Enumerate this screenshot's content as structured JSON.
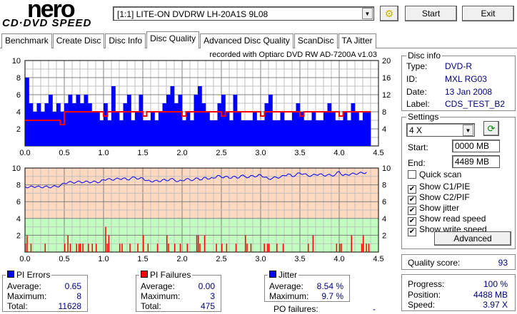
{
  "app": {
    "logo_top": "nero",
    "logo_bottom": "CD·DVD SPEED"
  },
  "toolbar": {
    "drive": "[1:1]  LITE-ON DVDRW LH-20A1S 9L08",
    "start": "Start",
    "exit": "Exit",
    "drive_icon": "drive-config-icon"
  },
  "tabs": [
    {
      "label": "Benchmark"
    },
    {
      "label": "Create Disc"
    },
    {
      "label": "Disc Info"
    },
    {
      "label": "Disc Quality",
      "active": true
    },
    {
      "label": "Advanced Disc Quality"
    },
    {
      "label": "ScanDisc"
    },
    {
      "label": "TA Jitter"
    }
  ],
  "disc_info": {
    "title": "Disc info",
    "type_label": "Type:",
    "type": "DVD-R",
    "id_label": "ID:",
    "id": "MXL RG03",
    "date_label": "Date:",
    "date": "13 Jan 2008",
    "label_label": "Label:",
    "label": "CDS_TEST_B2"
  },
  "settings": {
    "title": "Settings",
    "speed": "4 X",
    "start_label": "Start:",
    "start": "0000 MB",
    "end_label": "End:",
    "end": "4489 MB",
    "checks": [
      {
        "label": "Quick scan",
        "checked": false
      },
      {
        "label": "Show C1/PIE",
        "checked": true
      },
      {
        "label": "Show C2/PIF",
        "checked": true
      },
      {
        "label": "Show jitter",
        "checked": true
      },
      {
        "label": "Show read speed",
        "checked": true
      },
      {
        "label": "Show write speed",
        "checked": true
      }
    ],
    "advanced": "Advanced"
  },
  "quality": {
    "label": "Quality score:",
    "value": "93"
  },
  "progress": {
    "progress_label": "Progress:",
    "progress": "100 %",
    "position_label": "Position:",
    "position": "4488 MB",
    "speed_label": "Speed:",
    "speed": "3.97 X"
  },
  "pi_errors": {
    "title": "PI Errors",
    "color": "#0000ff",
    "avg_label": "Average:",
    "avg": "0.65",
    "max_label": "Maximum:",
    "max": "8",
    "total_label": "Total:",
    "total": "11628"
  },
  "pi_failures": {
    "title": "PI Failures",
    "color": "#ff0000",
    "avg_label": "Average:",
    "avg": "0.00",
    "max_label": "Maximum:",
    "max": "3",
    "total_label": "Total:",
    "total": "475"
  },
  "jitter": {
    "title": "Jitter",
    "color": "#0000ff",
    "avg_label": "Average:",
    "avg": "8.54 %",
    "max_label": "Maximum:",
    "max": "9.7 %",
    "po_label": "PO failures:",
    "po": "-"
  },
  "chart_data": [
    {
      "type": "bar",
      "title": "recorded with Optiarc DVD RW AD-7200A  v1.03",
      "xlim": [
        0,
        4.5
      ],
      "ylim": [
        0,
        10
      ],
      "y2lim": [
        0,
        20
      ],
      "xticks": [
        "0.0",
        "0.5",
        "1.0",
        "1.5",
        "2.0",
        "2.5",
        "3.0",
        "3.5",
        "4.0",
        "4.5"
      ],
      "yticks": [
        "2",
        "4",
        "6",
        "8",
        "10"
      ],
      "y2ticks": [
        "4",
        "8",
        "12",
        "16",
        "20"
      ],
      "grid": true,
      "x_step": 0.05,
      "pie": [
        8,
        5,
        4,
        5,
        4,
        5,
        6,
        4,
        5,
        4,
        5,
        6,
        5,
        6,
        5,
        6,
        5,
        4,
        4,
        3,
        5,
        3,
        7,
        4,
        3,
        5,
        6,
        3,
        4,
        6,
        3,
        3,
        4,
        3,
        4,
        5,
        6,
        7,
        5,
        6,
        3,
        4,
        3,
        6,
        7,
        5,
        4,
        3,
        3,
        5,
        6,
        4,
        3,
        6,
        4,
        3,
        3,
        3,
        4,
        3,
        3,
        5,
        6,
        3,
        3,
        4,
        3,
        3,
        4,
        5,
        4,
        3,
        3,
        4,
        3,
        3,
        4,
        5,
        4,
        3,
        3,
        4,
        3,
        5,
        4,
        3,
        4,
        4
      ],
      "read_speed": [
        6,
        6,
        6,
        6,
        6,
        6,
        6,
        6,
        6,
        5,
        8,
        8,
        8,
        8,
        8,
        8,
        8,
        8,
        8,
        8,
        7,
        8,
        8,
        8,
        8,
        8,
        8,
        8,
        8,
        8,
        7,
        8,
        8,
        8,
        8,
        8,
        8,
        8,
        8,
        8,
        7,
        8,
        8,
        8,
        8,
        8,
        8,
        8,
        8,
        8,
        7,
        8,
        8,
        8,
        8,
        8,
        8,
        8,
        8,
        8,
        7,
        8,
        8,
        8,
        8,
        8,
        8,
        8,
        8,
        8,
        7,
        8,
        8,
        8,
        8,
        8,
        8,
        8,
        8,
        8,
        7,
        8,
        8,
        8,
        8,
        8,
        8,
        8
      ],
      "pie_color": "#0000ff",
      "speed_color": "#ff0000"
    },
    {
      "type": "bar+line",
      "xlim": [
        0,
        4.5
      ],
      "ylim": [
        0,
        10
      ],
      "xticks": [
        "0.0",
        "0.5",
        "1.0",
        "1.5",
        "2.0",
        "2.5",
        "3.0",
        "3.5",
        "4.0",
        "4.5"
      ],
      "yticks": [
        "2",
        "4",
        "6",
        "8",
        "10"
      ],
      "y2ticks": [
        "2",
        "4",
        "6",
        "8",
        "10"
      ],
      "grid": true,
      "bands": [
        {
          "from": 0,
          "to": 4,
          "color": "#c0ffc0"
        },
        {
          "from": 4,
          "to": 10,
          "color": "#ffd8c0"
        }
      ],
      "pif": [
        [
          0.0,
          1
        ],
        [
          0.02,
          2
        ],
        [
          0.07,
          1
        ],
        [
          0.25,
          1
        ],
        [
          0.5,
          1
        ],
        [
          0.54,
          2
        ],
        [
          0.57,
          1
        ],
        [
          0.65,
          1
        ],
        [
          0.68,
          1
        ],
        [
          0.7,
          1
        ],
        [
          0.73,
          1
        ],
        [
          0.8,
          1
        ],
        [
          0.85,
          1
        ],
        [
          0.9,
          1
        ],
        [
          1.02,
          3
        ],
        [
          1.04,
          1
        ],
        [
          1.06,
          2
        ],
        [
          1.2,
          1
        ],
        [
          1.23,
          1
        ],
        [
          1.33,
          1
        ],
        [
          1.43,
          1
        ],
        [
          1.5,
          2
        ],
        [
          1.56,
          1
        ],
        [
          1.68,
          1
        ],
        [
          1.8,
          2
        ],
        [
          1.82,
          1
        ],
        [
          1.9,
          1
        ],
        [
          1.97,
          1
        ],
        [
          2.06,
          1
        ],
        [
          2.18,
          2
        ],
        [
          2.2,
          2
        ],
        [
          2.22,
          1
        ],
        [
          2.28,
          2
        ],
        [
          2.43,
          1
        ],
        [
          2.5,
          1
        ],
        [
          2.56,
          1
        ],
        [
          2.68,
          1
        ],
        [
          2.8,
          2
        ],
        [
          2.82,
          1
        ],
        [
          2.87,
          1
        ],
        [
          3.04,
          1
        ],
        [
          3.08,
          1
        ],
        [
          3.1,
          1
        ],
        [
          3.2,
          1
        ],
        [
          3.28,
          1
        ],
        [
          3.6,
          1
        ],
        [
          3.66,
          2
        ],
        [
          3.96,
          1
        ],
        [
          4.0,
          1
        ],
        [
          4.02,
          1
        ],
        [
          4.15,
          2
        ],
        [
          4.28,
          1
        ],
        [
          4.3,
          2
        ],
        [
          4.34,
          1
        ],
        [
          4.37,
          1
        ]
      ],
      "jitter": [
        7.8,
        7.7,
        7.8,
        7.8,
        7.7,
        7.8,
        7.7,
        7.8,
        7.8,
        7.9,
        8.2,
        8.3,
        8.3,
        8.3,
        8.4,
        8.3,
        8.4,
        8.3,
        8.4,
        8.3,
        8.6,
        8.7,
        8.6,
        8.7,
        8.7,
        8.8,
        8.6,
        8.8,
        8.9,
        8.7,
        8.8,
        8.5,
        8.4,
        8.5,
        8.4,
        8.6,
        8.5,
        8.7,
        8.6,
        8.4,
        8.5,
        8.7,
        8.6,
        8.6,
        8.8,
        8.6,
        8.9,
        8.7,
        8.8,
        9.1,
        8.9,
        9.0,
        8.8,
        9.0,
        8.8,
        9.1,
        9.0,
        8.9,
        9.1,
        9.0,
        9.2,
        8.9,
        8.7,
        8.8,
        8.9,
        8.9,
        9.1,
        9.3,
        9.0,
        9.2,
        9.4,
        9.3,
        9.1,
        9.1,
        9.2,
        9.3,
        9.1,
        9.2,
        9.1,
        9.2,
        9.6,
        9.1,
        9.2,
        9.3,
        9.3,
        9.4,
        9.4,
        9.5
      ],
      "pif_color": "#ff0000",
      "jitter_color": "#0000ff"
    }
  ]
}
